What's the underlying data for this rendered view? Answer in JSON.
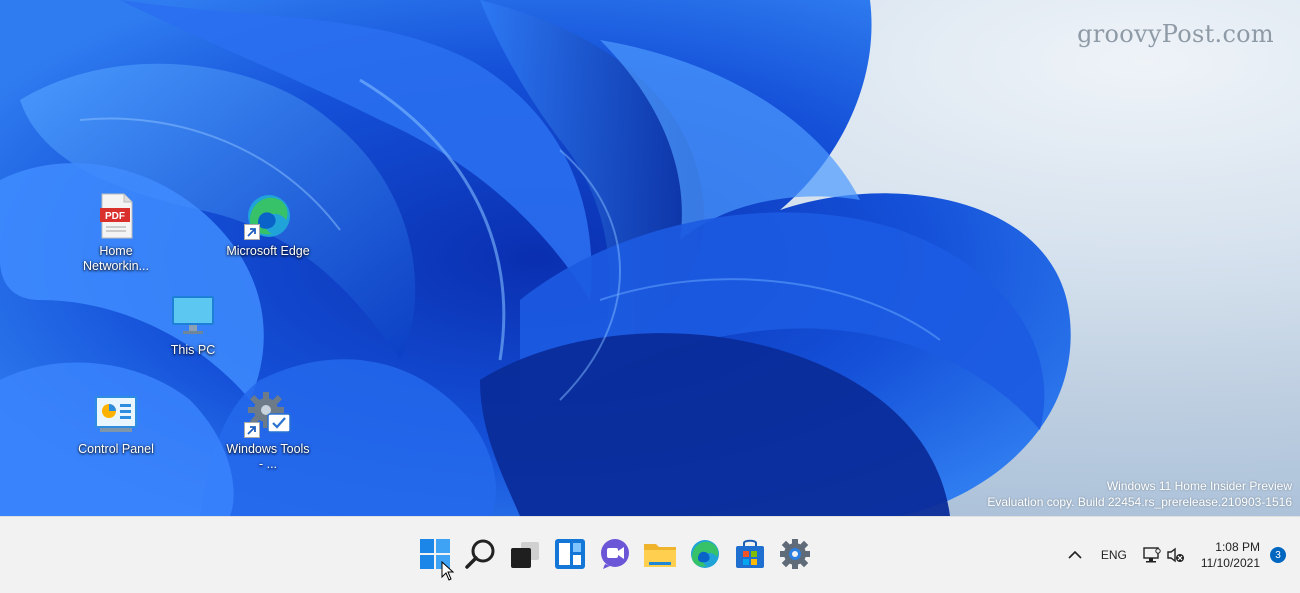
{
  "watermark": "groovyPost.com",
  "desktop": {
    "icons": [
      {
        "label": "Home Networkin...",
        "icon": "pdf-file-icon"
      },
      {
        "label": "Microsoft Edge",
        "icon": "edge-icon",
        "shortcut": true
      },
      {
        "label": "This PC",
        "icon": "monitor-icon"
      },
      {
        "label": "Control Panel",
        "icon": "control-panel-icon"
      },
      {
        "label": "Windows Tools - ...",
        "icon": "gear-check-icon",
        "shortcut": true
      }
    ],
    "eval_line1": "Windows 11 Home Insider Preview",
    "eval_line2": "Evaluation copy. Build 22454.rs_prerelease.210903-1516",
    "pdf_text": "PDF"
  },
  "taskbar": {
    "apps": [
      "start-icon",
      "search-icon",
      "task-view-icon",
      "widgets-icon",
      "chat-icon",
      "file-explorer-icon",
      "edge-icon",
      "store-icon",
      "settings-icon"
    ],
    "tray": {
      "chevron": "^",
      "language": "ENG",
      "time": "1:08 PM",
      "date": "11/10/2021",
      "notifications": "3"
    }
  },
  "colors": {
    "accent": "#0067c0",
    "wallpaper_blue": "#1a5fe0",
    "taskbar": "#f2f2f2"
  }
}
